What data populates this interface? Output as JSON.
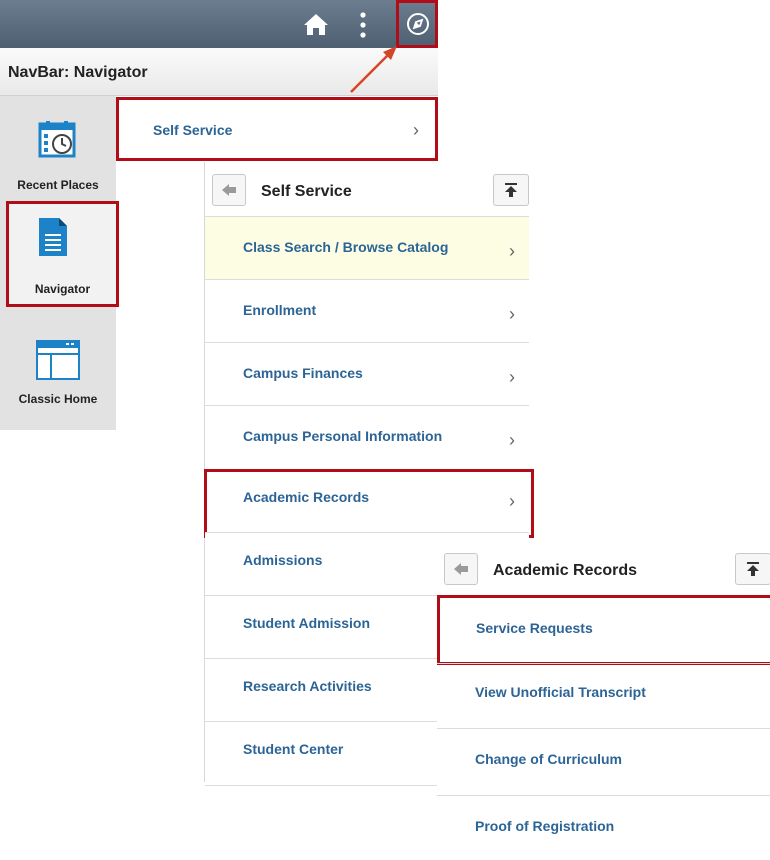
{
  "topbar": {
    "icons": [
      "home-icon",
      "more-vertical-icon",
      "compass-icon"
    ]
  },
  "navbar": {
    "title": "NavBar: Navigator"
  },
  "left_rail": {
    "tiles": [
      {
        "label": "Recent Places",
        "icon": "calendar-clock-icon"
      },
      {
        "label": "Navigator",
        "icon": "document-icon"
      },
      {
        "label": "Classic Home",
        "icon": "window-layout-icon"
      }
    ]
  },
  "navigator_menu": {
    "item": "Self Service"
  },
  "self_service_panel": {
    "title": "Self Service",
    "items": [
      "Class Search / Browse Catalog",
      "Enrollment",
      "Campus Finances",
      "Campus Personal Information",
      "Academic Records",
      "Admissions",
      "Student Admission",
      "Research Activities",
      "Student Center"
    ]
  },
  "academic_records_panel": {
    "title": "Academic Records",
    "items": [
      "Service Requests",
      "View Unofficial Transcript",
      "Change of Curriculum",
      "Proof of Registration"
    ]
  },
  "colors": {
    "link": "#2c6496",
    "highlight_border": "#b00d18",
    "topbar": "#56687a"
  }
}
